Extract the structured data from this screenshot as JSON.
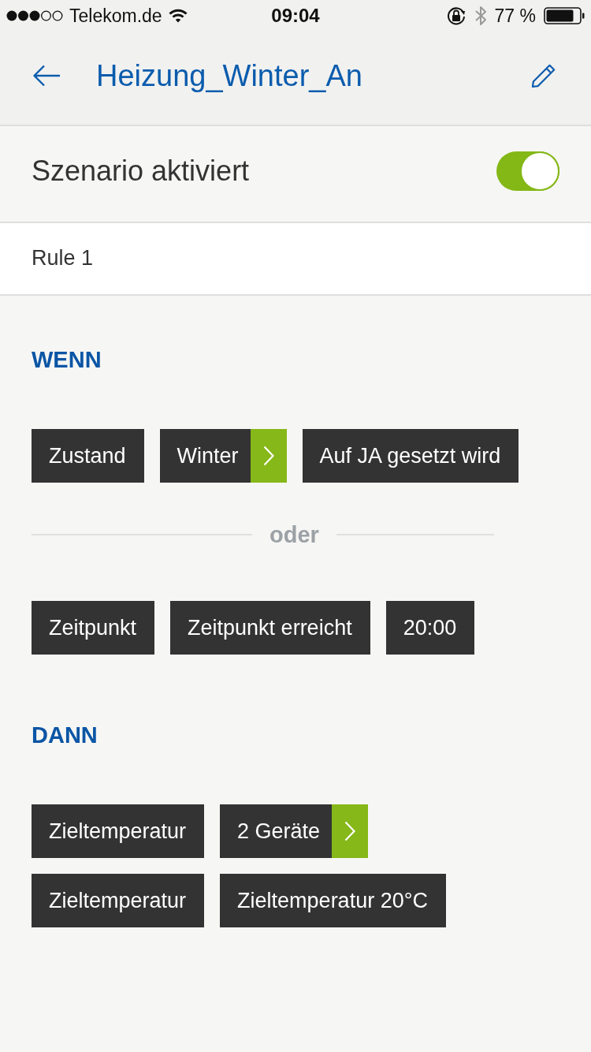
{
  "status_bar": {
    "carrier": "Telekom.de",
    "time": "09:04",
    "battery": "77 %"
  },
  "header": {
    "title": "Heizung_Winter_An"
  },
  "scenario": {
    "label": "Szenario aktiviert",
    "on": true
  },
  "rule": {
    "title": "Rule 1"
  },
  "sections": [
    {
      "heading": "WENN",
      "blocks": [
        {
          "kind": "row",
          "tags": [
            {
              "label": "Zustand",
              "kind": "plain"
            },
            {
              "label": "Winter",
              "kind": "link"
            },
            {
              "label": "Auf JA gesetzt wird",
              "kind": "plain"
            }
          ]
        },
        {
          "kind": "divider",
          "label": "oder"
        },
        {
          "kind": "row",
          "tags": [
            {
              "label": "Zeitpunkt",
              "kind": "plain"
            },
            {
              "label": "Zeitpunkt erreicht",
              "kind": "plain"
            },
            {
              "label": "20:00",
              "kind": "plain"
            }
          ]
        }
      ]
    },
    {
      "heading": "DANN",
      "blocks": [
        {
          "kind": "row",
          "tags": [
            {
              "label": "Zieltemperatur",
              "kind": "plain"
            },
            {
              "label": "2 Geräte",
              "kind": "link"
            }
          ]
        },
        {
          "kind": "row",
          "tags": [
            {
              "label": "Zieltemperatur",
              "kind": "plain"
            },
            {
              "label": "Zieltemperatur 20°C",
              "kind": "plain"
            }
          ]
        }
      ]
    }
  ]
}
